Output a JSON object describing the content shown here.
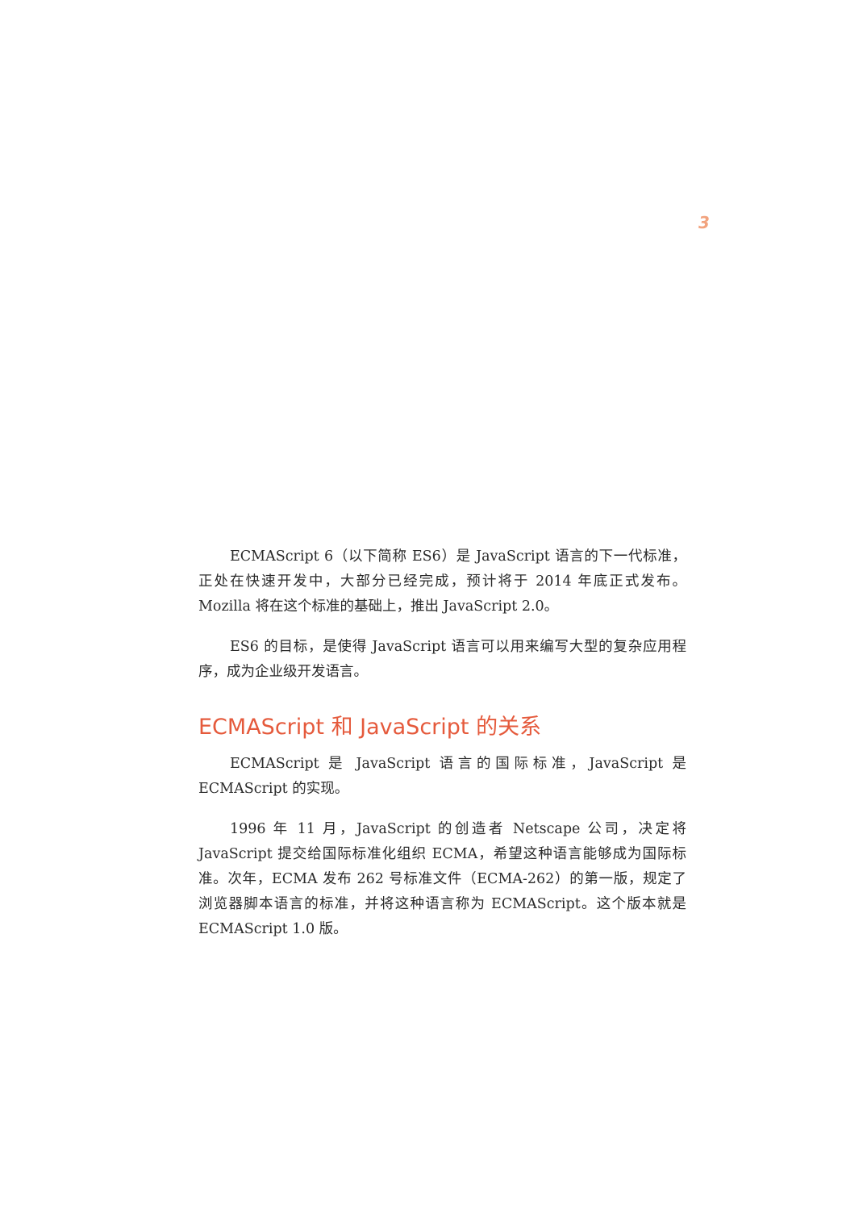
{
  "page": {
    "chapter_number": "3"
  },
  "paragraphs_before": [
    "ECMAScript 6（以下简称 ES6）是 JavaScript 语言的下一代标准，正处在快速开发中，大部分已经完成，预计将于 2014 年底正式发布。Mozilla 将在这个标准的基础上，推出 JavaScript 2.0。",
    "ES6 的目标，是使得 JavaScript 语言可以用来编写大型的复杂应用程序，成为企业级开发语言。"
  ],
  "section": {
    "heading": "ECMAScript 和 JavaScript 的关系",
    "paragraphs": [
      "ECMAScript 是 JavaScript 语言的国际标准，JavaScript 是 ECMAScript 的实现。",
      "1996 年 11 月，JavaScript 的创造者 Netscape 公司，决定将 JavaScript 提交给国际标准化组织 ECMA，希望这种语言能够成为国际标准。次年，ECMA 发布 262 号标准文件（ECMA-262）的第一版，规定了浏览器脚本语言的标准，并将这种语言称为 ECMAScript。这个版本就是 ECMAScript 1.0 版。"
    ]
  },
  "colors": {
    "heading": "#e55a3c",
    "chapter_number": "#f2a37e",
    "body_text": "#2a2a2a"
  }
}
